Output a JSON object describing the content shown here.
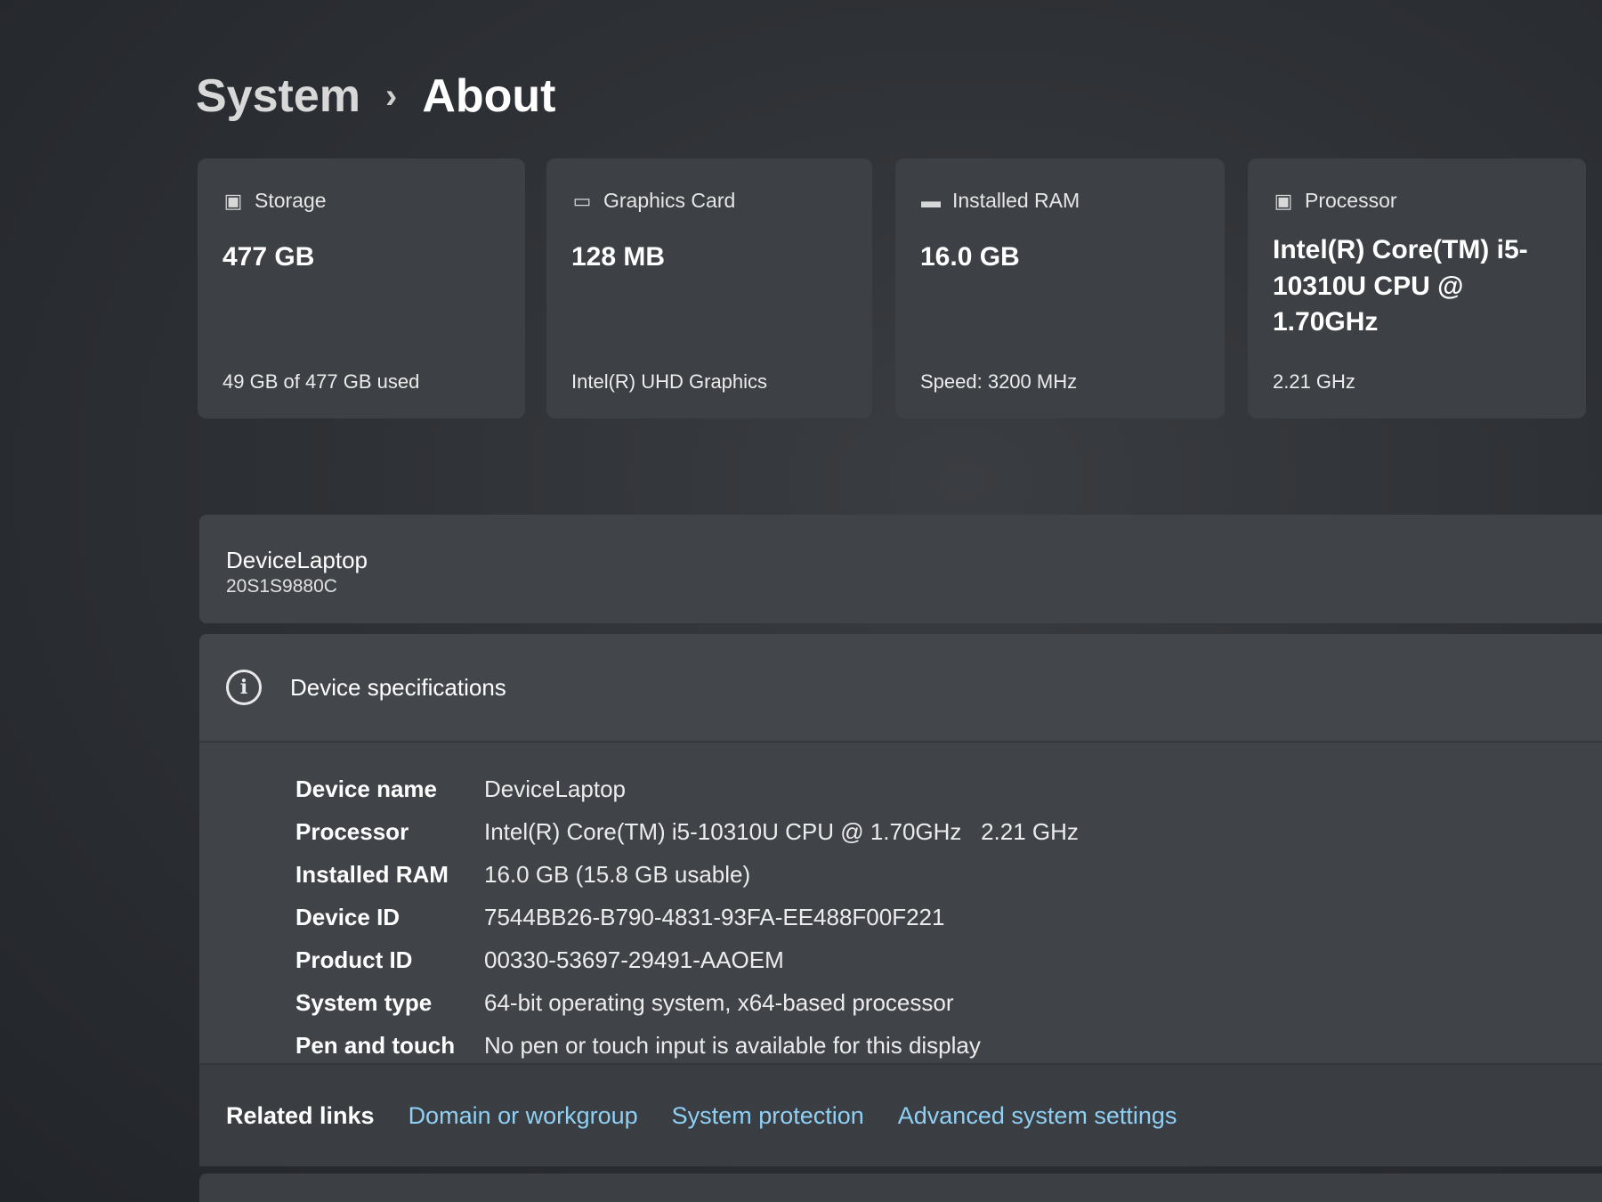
{
  "breadcrumb": {
    "parent": "System",
    "separator": "›",
    "current": "About"
  },
  "cards": [
    {
      "icon": "storage-icon",
      "title": "Storage",
      "value": "477 GB",
      "sub": "49 GB of 477 GB used"
    },
    {
      "icon": "graphics-card-icon",
      "title": "Graphics Card",
      "value": "128 MB",
      "sub": "Intel(R) UHD Graphics"
    },
    {
      "icon": "ram-icon",
      "title": "Installed RAM",
      "value": "16.0 GB",
      "sub": "Speed: 3200 MHz"
    },
    {
      "icon": "processor-icon",
      "title": "Processor",
      "value": "Intel(R) Core(TM) i5-10310U CPU @ 1.70GHz",
      "sub": "2.21 GHz"
    }
  ],
  "device": {
    "name": "DeviceLaptop",
    "model": "20S1S9880C"
  },
  "specs": {
    "title": "Device specifications",
    "rows": [
      {
        "label": "Device name",
        "value": "DeviceLaptop"
      },
      {
        "label": "Processor",
        "value": "Intel(R) Core(TM) i5-10310U CPU @ 1.70GHz   2.21 GHz"
      },
      {
        "label": "Installed RAM",
        "value": "16.0 GB (15.8 GB usable)"
      },
      {
        "label": "Device ID",
        "value": "7544BB26-B790-4831-93FA-EE488F00F221"
      },
      {
        "label": "Product ID",
        "value": "00330-53697-29491-AAOEM"
      },
      {
        "label": "System type",
        "value": "64-bit operating system, x64-based processor"
      },
      {
        "label": "Pen and touch",
        "value": "No pen or touch input is available for this display"
      }
    ]
  },
  "related": {
    "label": "Related links",
    "links": [
      "Domain or workgroup",
      "System protection",
      "Advanced system settings"
    ]
  }
}
